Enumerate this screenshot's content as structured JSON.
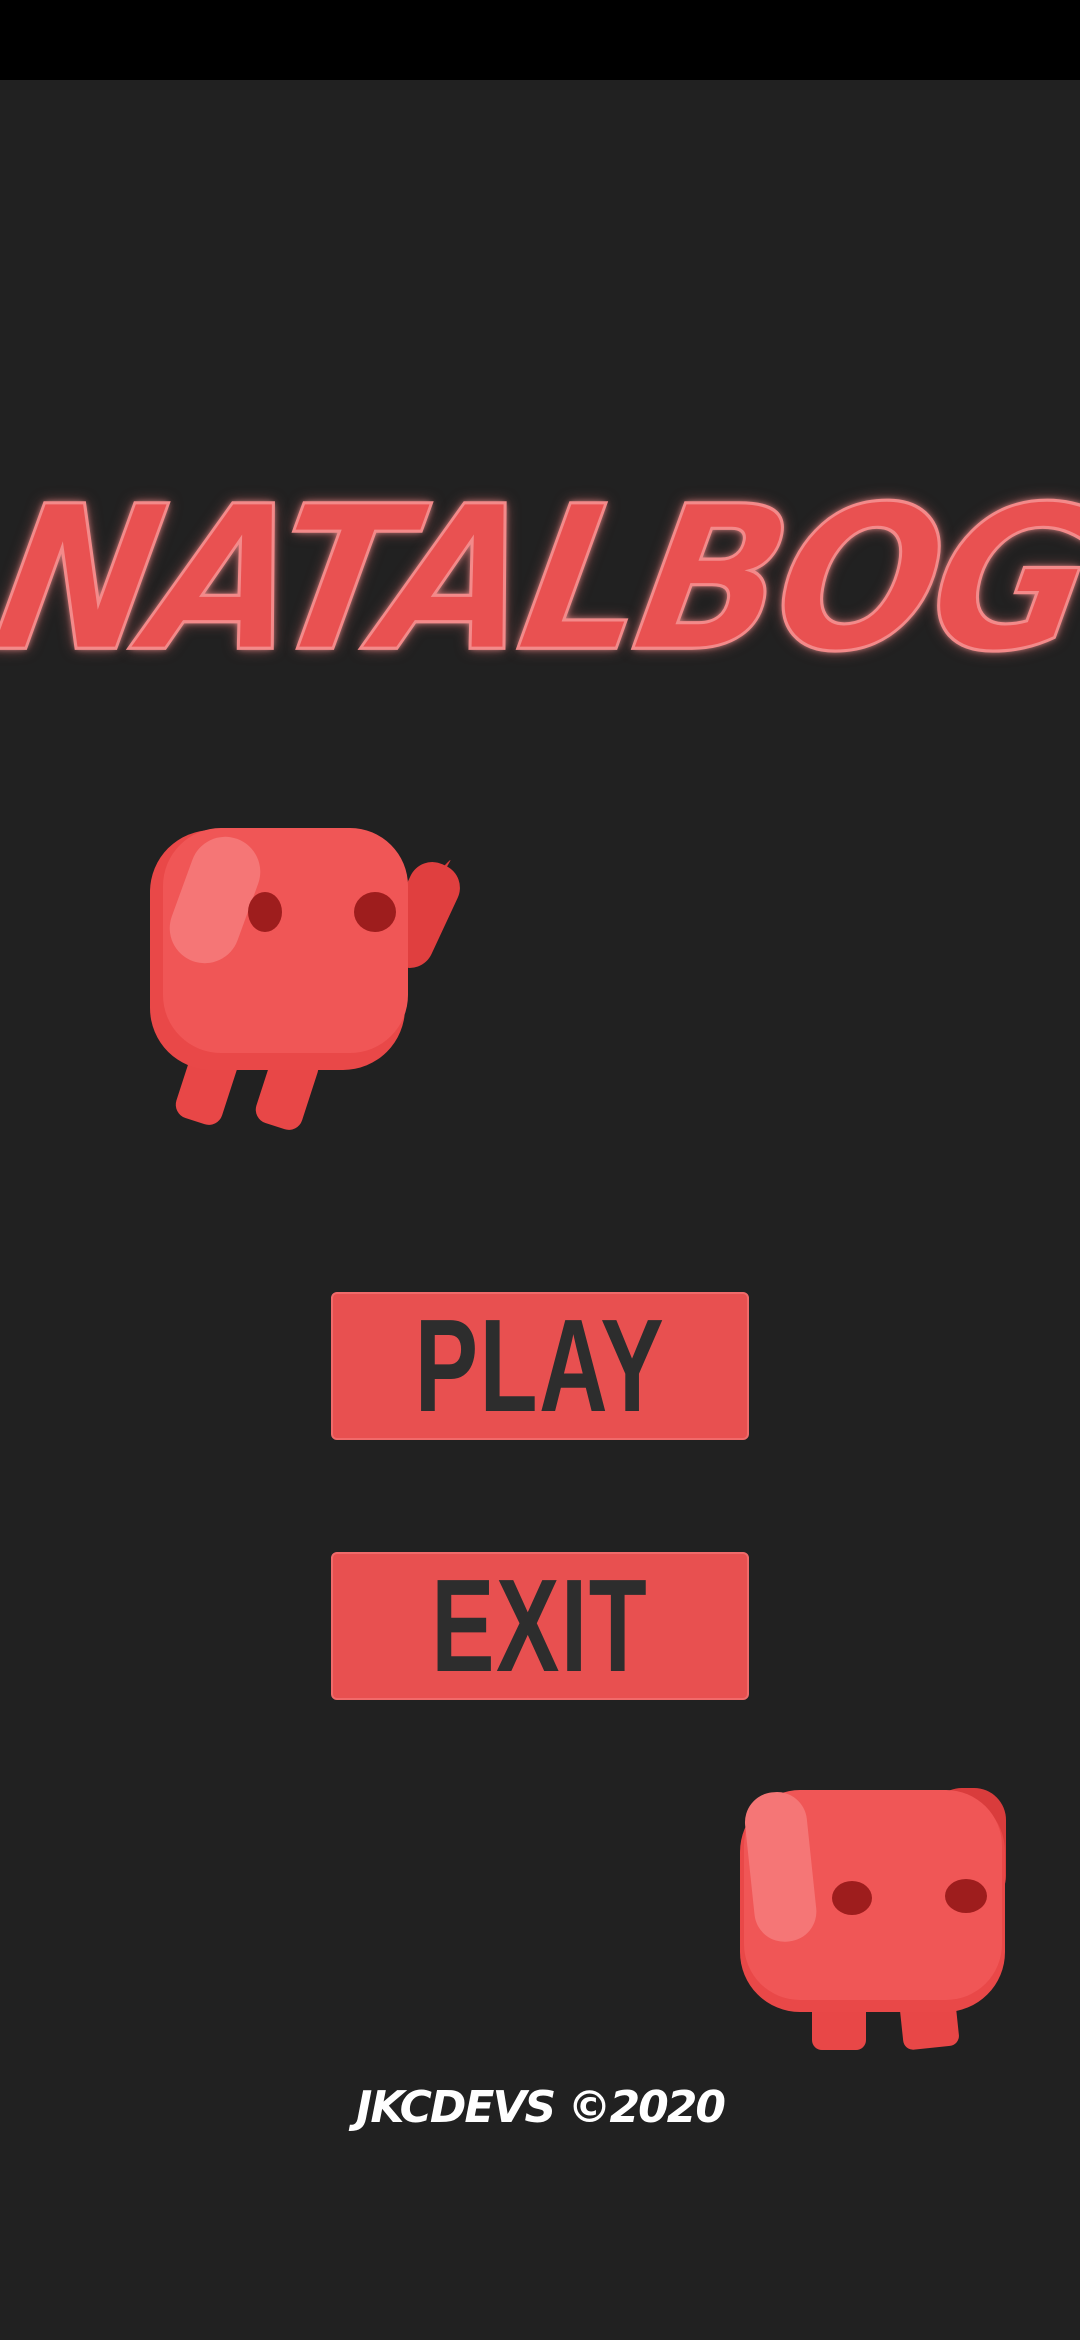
{
  "app": {
    "title": "NATALBOG"
  },
  "menu": {
    "play_label": "PLAY",
    "exit_label": "EXIT"
  },
  "footer": {
    "credits": "JKCDEVS ©2020"
  },
  "colors": {
    "background": "#212121",
    "accent": "#e85050",
    "button_text": "#2d2d2d",
    "status_bar": "#000000"
  },
  "icons": {
    "character_1": "red-blob-character-icon",
    "character_2": "red-blob-character-icon"
  }
}
